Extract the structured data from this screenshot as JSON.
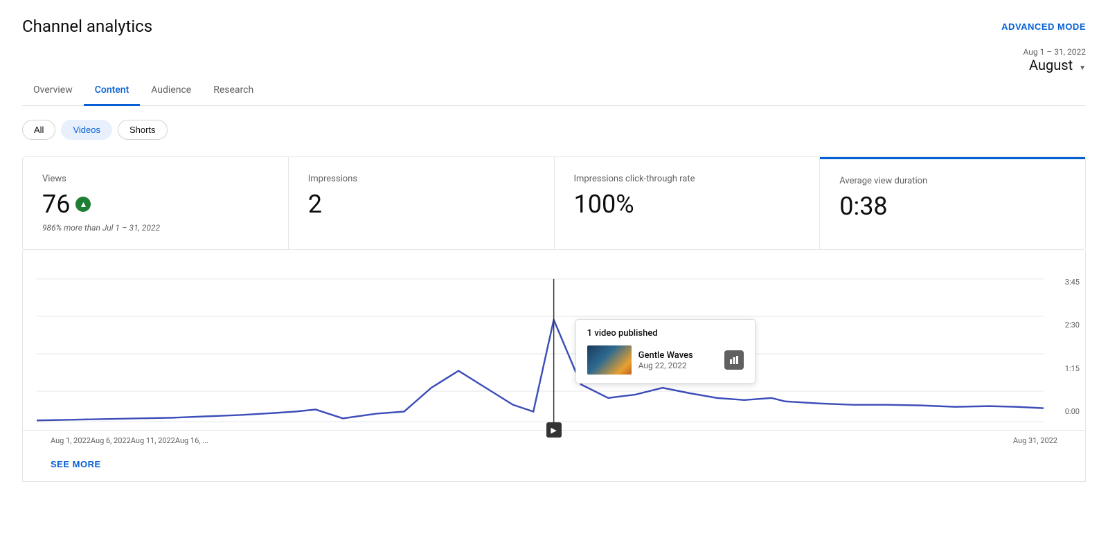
{
  "header": {
    "title": "Channel analytics",
    "advanced_mode_label": "ADVANCED MODE"
  },
  "date_range": {
    "label": "Aug 1 – 31, 2022",
    "value": "August"
  },
  "nav_tabs": [
    {
      "id": "overview",
      "label": "Overview",
      "active": false
    },
    {
      "id": "content",
      "label": "Content",
      "active": true
    },
    {
      "id": "audience",
      "label": "Audience",
      "active": false
    },
    {
      "id": "research",
      "label": "Research",
      "active": false
    }
  ],
  "filter_pills": [
    {
      "id": "all",
      "label": "All",
      "active": false
    },
    {
      "id": "videos",
      "label": "Videos",
      "active": true
    },
    {
      "id": "shorts",
      "label": "Shorts",
      "active": false
    }
  ],
  "metrics": [
    {
      "id": "views",
      "label": "Views",
      "value": "76",
      "has_up_arrow": true,
      "sub_text": "986% more than Jul 1 – 31, 2022"
    },
    {
      "id": "impressions",
      "label": "Impressions",
      "value": "2",
      "has_up_arrow": false,
      "sub_text": ""
    },
    {
      "id": "ctr",
      "label": "Impressions click-through rate",
      "value": "100%",
      "has_up_arrow": false,
      "sub_text": ""
    },
    {
      "id": "avg_view_duration",
      "label": "Average view duration",
      "value": "0:38",
      "has_up_arrow": false,
      "sub_text": ""
    }
  ],
  "chart": {
    "y_axis_labels": [
      "3:45",
      "2:30",
      "1:15",
      "0:00"
    ],
    "x_axis_labels": [
      "Aug 1, 2022",
      "Aug 6, 2022",
      "Aug 11, 2022",
      "Aug 16, ...",
      "Aug 31, 2022"
    ]
  },
  "tooltip": {
    "header": "1 video published",
    "video_title": "Gentle Waves",
    "video_date": "Aug 22, 2022"
  },
  "see_more_label": "SEE MORE",
  "colors": {
    "accent_blue": "#065fd4",
    "line_color": "#3d4eb8",
    "up_arrow_bg": "#1e7e34"
  }
}
